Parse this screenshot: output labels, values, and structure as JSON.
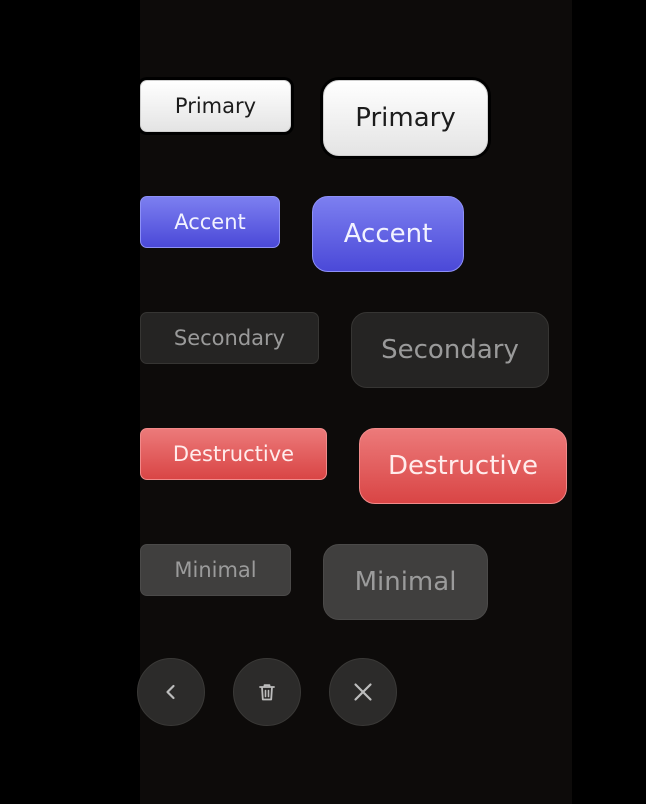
{
  "buttons": {
    "primary": {
      "label": "Primary"
    },
    "accent": {
      "label": "Accent"
    },
    "secondary": {
      "label": "Secondary"
    },
    "destructive": {
      "label": "Destructive"
    },
    "minimal": {
      "label": "Minimal"
    }
  },
  "icon_buttons": [
    {
      "icon": "chevron-left-icon"
    },
    {
      "icon": "trash-icon"
    },
    {
      "icon": "close-icon"
    }
  ],
  "colors": {
    "background": "#0d0b0a",
    "primary": "#f0f0f0",
    "accent": "#5b5be0",
    "secondary": "#252423",
    "destructive": "#e05555",
    "minimal": "#403f3e"
  }
}
